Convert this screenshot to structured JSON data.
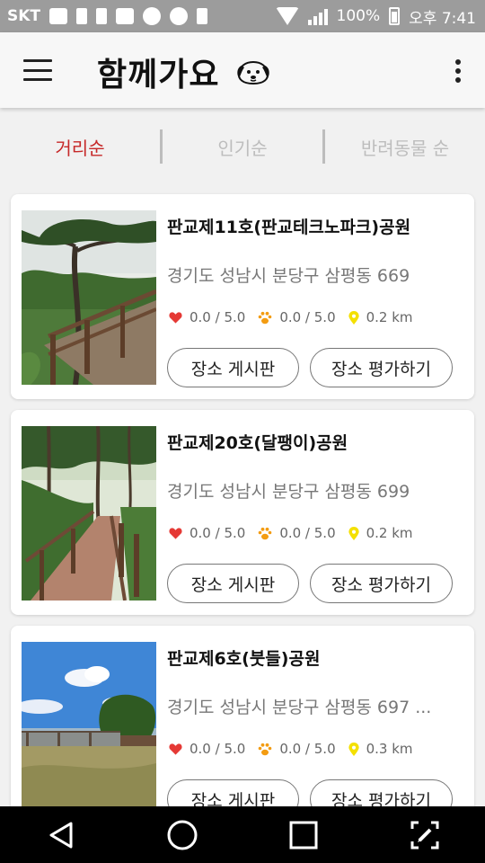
{
  "status_bar": {
    "carrier": "SKT",
    "battery": "100%",
    "time": "오후 7:41"
  },
  "app_bar": {
    "title": "함께가요"
  },
  "tabs": [
    {
      "label": "거리순",
      "active": true
    },
    {
      "label": "인기순",
      "active": false
    },
    {
      "label": "반려동물 순",
      "active": false
    }
  ],
  "places": [
    {
      "name": "판교제11호(판교테크노파크)공원",
      "address": "경기도 성남시 분당구 삼평동 669",
      "rating": "0.0 / 5.0",
      "pet_rating": "0.0 / 5.0",
      "distance": "0.2 km",
      "board_button": "장소 게시판",
      "rate_button": "장소 평가하기"
    },
    {
      "name": "판교제20호(달팽이)공원",
      "address": "경기도 성남시 분당구 삼평동 699",
      "rating": "0.0 / 5.0",
      "pet_rating": "0.0 / 5.0",
      "distance": "0.2 km",
      "board_button": "장소 게시판",
      "rate_button": "장소 평가하기"
    },
    {
      "name": "판교제6호(붓들)공원",
      "address": "경기도 성남시 분당구 삼평동 697 ...",
      "rating": "0.0 / 5.0",
      "pet_rating": "0.0 / 5.0",
      "distance": "0.3 km",
      "board_button": "장소 게시판",
      "rate_button": "장소 평가하기"
    }
  ],
  "colors": {
    "active_tab": "#c62828",
    "heart": "#e53935",
    "paw": "#f39c12",
    "pin": "#f4e000"
  },
  "icons": [
    "menu-icon",
    "dog-logo-icon",
    "more-vert-icon",
    "heart-icon",
    "paw-icon",
    "location-pin-icon",
    "back-icon",
    "home-icon",
    "recents-icon",
    "screenshot-edit-icon"
  ]
}
